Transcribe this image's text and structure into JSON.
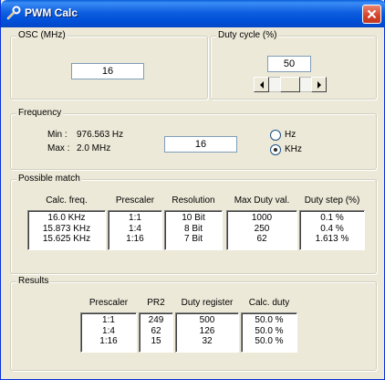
{
  "window": {
    "title": "PWM Calc"
  },
  "osc": {
    "legend": "OSC (MHz)",
    "value": "16"
  },
  "duty": {
    "legend": "Duty cycle (%)",
    "value": "50",
    "slider_position_pct": 50
  },
  "frequency": {
    "legend": "Frequency",
    "min_label": "Min :",
    "min_value": "976.563 Hz",
    "max_label": "Max :",
    "max_value": "2.0 MHz",
    "input_value": "16",
    "unit_hz": "Hz",
    "unit_khz": "KHz",
    "selected_unit": "KHz"
  },
  "possible_match": {
    "legend": "Possible match",
    "headers": [
      "Calc. freq.",
      "Prescaler",
      "Resolution",
      "Max Duty val.",
      "Duty step (%)"
    ],
    "columns": [
      [
        "16.0 KHz",
        "15.873 KHz",
        "15.625 KHz"
      ],
      [
        "1:1",
        "1:4",
        "1:16"
      ],
      [
        "10 Bit",
        "8 Bit",
        "7 Bit"
      ],
      [
        "1000",
        "250",
        "62"
      ],
      [
        "0.1 %",
        "0.4 %",
        "1.613 %"
      ]
    ]
  },
  "results": {
    "legend": "Results",
    "headers": [
      "Prescaler",
      "PR2",
      "Duty register",
      "Calc. duty"
    ],
    "columns": [
      [
        "1:1",
        "1:4",
        "1:16"
      ],
      [
        "249",
        "62",
        "15"
      ],
      [
        "500",
        "126",
        "32"
      ],
      [
        "50.0 %",
        "50.0 %",
        "50.0 %"
      ]
    ]
  }
}
